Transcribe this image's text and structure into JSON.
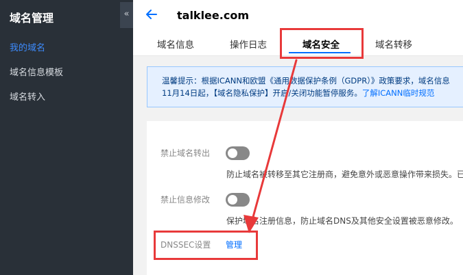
{
  "sidebar": {
    "title": "域名管理",
    "collapse_glyph": "«",
    "items": [
      {
        "label": "我的域名",
        "active": true
      },
      {
        "label": "域名信息模板",
        "active": false
      },
      {
        "label": "域名转入",
        "active": false
      }
    ]
  },
  "header": {
    "domain": "talklee.com",
    "tabs": [
      {
        "label": "域名信息"
      },
      {
        "label": "操作日志"
      },
      {
        "label": "域名安全",
        "active": true
      },
      {
        "label": "域名转移"
      }
    ]
  },
  "notice": {
    "line1": "温馨提示：根据ICANN和欧盟《通用数据保护条例（GDPR）》政策要求，域名信息",
    "line2_prefix": "11月14日起，【域名隐私保护】开启/关闭功能暂停服务。",
    "line2_link": "了解ICANN临时规范"
  },
  "security": {
    "transfer_lock": {
      "label": "禁止域名转出",
      "enabled": false,
      "desc": "防止域名被转移至其它注册商，避免意外或恶意操作带来损失。已"
    },
    "update_lock": {
      "label": "禁止信息修改",
      "enabled": false,
      "desc": "保护域名注册信息，防止域名DNS及其他安全设置被恶意修改。"
    },
    "dnssec": {
      "label": "DNSSEC设置",
      "action": "管理"
    }
  },
  "colors": {
    "accent": "#006eff",
    "sidebar_bg": "#293038",
    "sidebar_active": "#3d8bfd",
    "annotation_red": "#e8393a"
  }
}
